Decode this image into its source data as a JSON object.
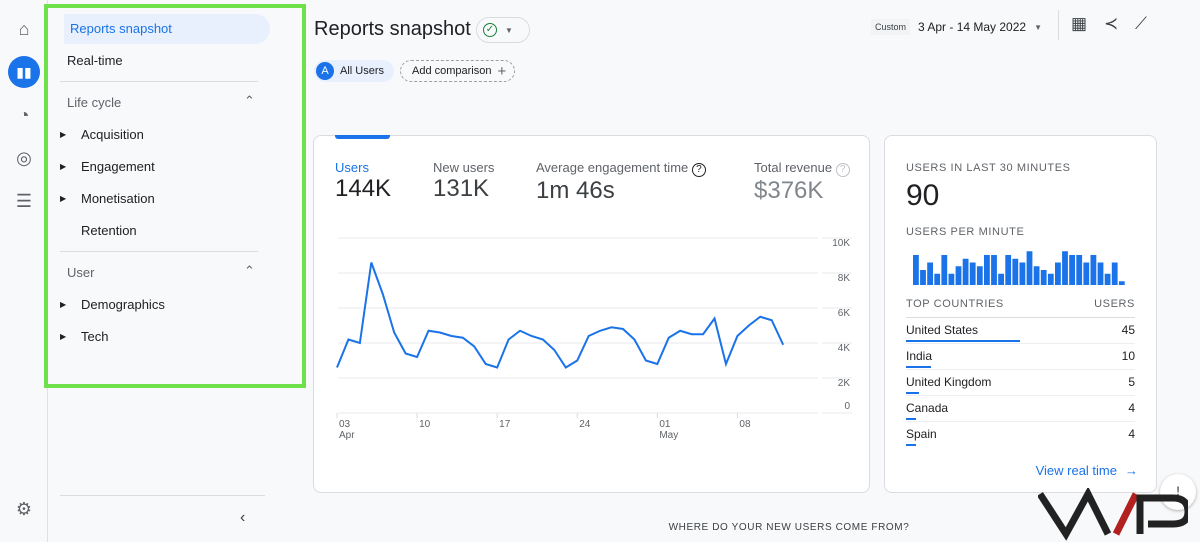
{
  "rail": {
    "icons": [
      "home-icon",
      "reports-icon",
      "explore-icon",
      "advertising-icon",
      "configure-icon",
      "settings-icon"
    ]
  },
  "sidebar": {
    "reports_snapshot": "Reports snapshot",
    "realtime": "Real-time",
    "lifecycle": {
      "label": "Life cycle",
      "items": [
        "Acquisition",
        "Engagement",
        "Monetisation",
        "Retention"
      ]
    },
    "user": {
      "label": "User",
      "items": [
        "Demographics",
        "Tech"
      ]
    }
  },
  "header": {
    "title": "Reports snapshot",
    "date_prefix": "Custom",
    "date_range": "3 Apr - 14 May 2022",
    "segment_letter": "A",
    "segment": "All Users",
    "add_comparison": "Add comparison"
  },
  "metrics": [
    {
      "label": "Users",
      "value": "144K"
    },
    {
      "label": "New users",
      "value": "131K"
    },
    {
      "label": "Average engagement time",
      "value": "1m 46s"
    },
    {
      "label": "Total revenue",
      "value": "$376K"
    }
  ],
  "chart_data": {
    "type": "line",
    "series": [
      {
        "values": [
          2.6,
          4.2,
          4.0,
          8.6,
          6.8,
          4.6,
          3.4,
          3.2,
          4.7,
          4.6,
          4.4,
          4.3,
          3.8,
          2.8,
          2.6,
          4.2,
          4.7,
          4.4,
          4.2,
          3.6,
          2.6,
          3.0,
          4.4,
          4.7,
          4.9,
          4.8,
          4.2,
          3.0,
          2.8,
          4.3,
          4.7,
          4.5,
          4.5,
          5.4,
          2.8,
          4.4,
          5.0,
          5.5,
          5.3,
          3.9
        ]
      }
    ],
    "unit": "thousands of users per day",
    "x_start": "03 Apr",
    "x_end": "12 May",
    "ylim": [
      0,
      10
    ],
    "y_ticks": [
      "10K",
      "8K",
      "6K",
      "4K",
      "2K",
      "0"
    ],
    "x_ticks": [
      {
        "day": "03",
        "month": "Apr"
      },
      {
        "day": "10",
        "month": ""
      },
      {
        "day": "17",
        "month": ""
      },
      {
        "day": "24",
        "month": ""
      },
      {
        "day": "01",
        "month": "May"
      },
      {
        "day": "08",
        "month": ""
      }
    ],
    "grid": true,
    "color": "#1a73e8"
  },
  "realtime": {
    "title": "USERS IN LAST 30 MINUTES",
    "value": "90",
    "per_minute_label": "USERS PER MINUTE",
    "per_minute": [
      8,
      4,
      6,
      3,
      8,
      3,
      5,
      7,
      6,
      5,
      8,
      8,
      3,
      8,
      7,
      6,
      9,
      5,
      4,
      3,
      6,
      9,
      8,
      8,
      6,
      8,
      6,
      3,
      6,
      1
    ],
    "countries_header": "TOP COUNTRIES",
    "users_header": "USERS",
    "countries": [
      {
        "name": "United States",
        "users": "45"
      },
      {
        "name": "India",
        "users": "10"
      },
      {
        "name": "United Kingdom",
        "users": "5"
      },
      {
        "name": "Canada",
        "users": "4"
      },
      {
        "name": "Spain",
        "users": "4"
      }
    ],
    "view_link": "View real time"
  },
  "bottom_heading": "WHERE DO YOUR NEW USERS COME FROM?",
  "colors": {
    "accent": "#1a73e8",
    "highlight_border": "#6ee04a"
  }
}
